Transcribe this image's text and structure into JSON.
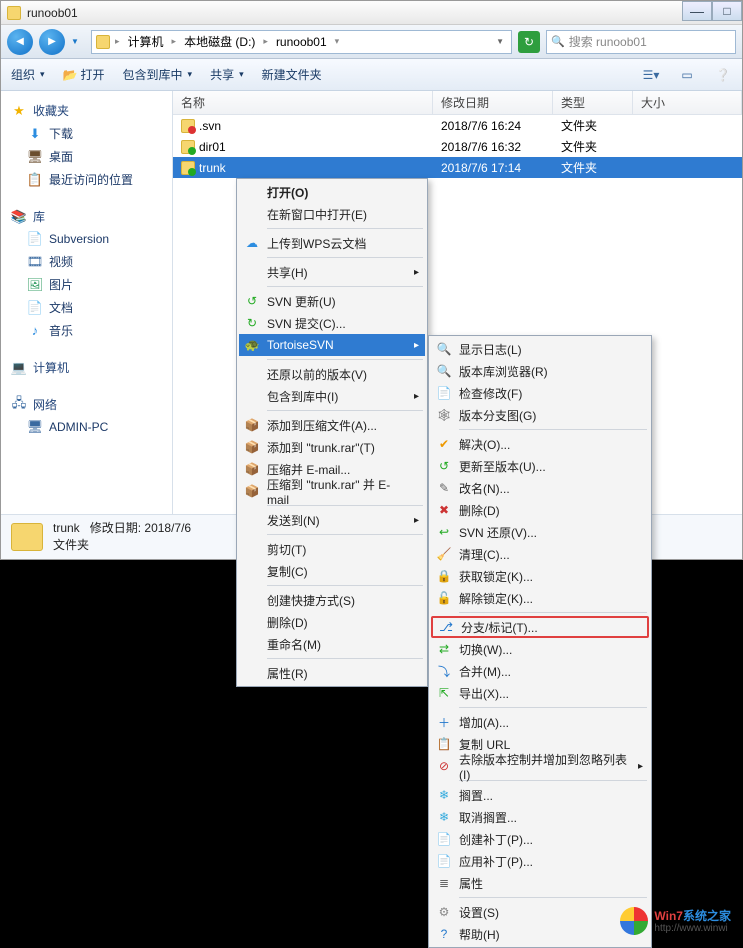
{
  "title": "runoob01",
  "breadcrumb": {
    "p1": "计算机",
    "p2": "本地磁盘 (D:)",
    "p3": "runoob01"
  },
  "search_placeholder": "搜索 runoob01",
  "toolbar": {
    "org": "组织",
    "open": "打开",
    "include": "包含到库中",
    "share": "共享",
    "newf": "新建文件夹"
  },
  "sidebar": {
    "fav": "收藏夹",
    "down": "下载",
    "desk": "桌面",
    "recent": "最近访问的位置",
    "lib": "库",
    "svn": "Subversion",
    "vid": "视频",
    "pic": "图片",
    "doc": "文档",
    "mus": "音乐",
    "comp": "计算机",
    "net": "网络",
    "pc": "ADMIN-PC"
  },
  "cols": {
    "name": "名称",
    "date": "修改日期",
    "type": "类型",
    "size": "大小"
  },
  "files": [
    {
      "name": ".svn",
      "date": "2018/7/6 16:24",
      "type": "文件夹",
      "cls": "svn"
    },
    {
      "name": "dir01",
      "date": "2018/7/6 16:32",
      "type": "文件夹",
      "cls": "ok"
    },
    {
      "name": "trunk",
      "date": "2018/7/6 17:14",
      "type": "文件夹",
      "cls": "ok",
      "sel": true
    }
  ],
  "details": {
    "name": "trunk",
    "mod_lbl": "修改日期:",
    "mod": "2018/7/6",
    "type": "文件夹"
  },
  "menu1": [
    {
      "t": "item",
      "label": "打开(O)",
      "bold": true
    },
    {
      "t": "item",
      "label": "在新窗口中打开(E)"
    },
    {
      "t": "sep"
    },
    {
      "t": "item",
      "label": "上传到WPS云文档",
      "ico": "☁",
      "icoc": "#2c8de0"
    },
    {
      "t": "sep"
    },
    {
      "t": "item",
      "label": "共享(H)",
      "sub": true
    },
    {
      "t": "sep"
    },
    {
      "t": "item",
      "label": "SVN 更新(U)",
      "ico": "↺",
      "icoc": "#2a2"
    },
    {
      "t": "item",
      "label": "SVN 提交(C)...",
      "ico": "↻",
      "icoc": "#2a2"
    },
    {
      "t": "item",
      "label": "TortoiseSVN",
      "sub": true,
      "hl": true,
      "ico": "🐢",
      "icoc": "#fff"
    },
    {
      "t": "sep"
    },
    {
      "t": "item",
      "label": "还原以前的版本(V)"
    },
    {
      "t": "item",
      "label": "包含到库中(I)",
      "sub": true
    },
    {
      "t": "sep"
    },
    {
      "t": "item",
      "label": "添加到压缩文件(A)...",
      "ico": "📦",
      "icoc": "#b33"
    },
    {
      "t": "item",
      "label": "添加到 \"trunk.rar\"(T)",
      "ico": "📦",
      "icoc": "#b33"
    },
    {
      "t": "item",
      "label": "压缩并 E-mail...",
      "ico": "📦",
      "icoc": "#b33"
    },
    {
      "t": "item",
      "label": "压缩到 \"trunk.rar\" 并 E-mail",
      "ico": "📦",
      "icoc": "#b33"
    },
    {
      "t": "sep"
    },
    {
      "t": "item",
      "label": "发送到(N)",
      "sub": true
    },
    {
      "t": "sep"
    },
    {
      "t": "item",
      "label": "剪切(T)"
    },
    {
      "t": "item",
      "label": "复制(C)"
    },
    {
      "t": "sep"
    },
    {
      "t": "item",
      "label": "创建快捷方式(S)"
    },
    {
      "t": "item",
      "label": "删除(D)"
    },
    {
      "t": "item",
      "label": "重命名(M)"
    },
    {
      "t": "sep"
    },
    {
      "t": "item",
      "label": "属性(R)"
    }
  ],
  "menu2": [
    {
      "t": "item",
      "label": "显示日志(L)",
      "ico": "🔍"
    },
    {
      "t": "item",
      "label": "版本库浏览器(R)",
      "ico": "🔍"
    },
    {
      "t": "item",
      "label": "检查修改(F)",
      "ico": "📄"
    },
    {
      "t": "item",
      "label": "版本分支图(G)",
      "ico": "🕸"
    },
    {
      "t": "sep"
    },
    {
      "t": "item",
      "label": "解决(O)...",
      "ico": "✔",
      "icoc": "#e90"
    },
    {
      "t": "item",
      "label": "更新至版本(U)...",
      "ico": "↺",
      "icoc": "#2a2"
    },
    {
      "t": "item",
      "label": "改名(N)...",
      "ico": "✎"
    },
    {
      "t": "item",
      "label": "删除(D)",
      "ico": "✖",
      "icoc": "#c33"
    },
    {
      "t": "item",
      "label": "SVN 还原(V)...",
      "ico": "↩",
      "icoc": "#2a2"
    },
    {
      "t": "item",
      "label": "清理(C)...",
      "ico": "🧹",
      "icoc": "#e90"
    },
    {
      "t": "item",
      "label": "获取锁定(K)...",
      "ico": "🔒",
      "icoc": "#c90"
    },
    {
      "t": "item",
      "label": "解除锁定(K)...",
      "ico": "🔓",
      "icoc": "#c90"
    },
    {
      "t": "sep"
    },
    {
      "t": "item",
      "label": "分支/标记(T)...",
      "ico": "⎇",
      "icoc": "#27c",
      "box": true
    },
    {
      "t": "item",
      "label": "切换(W)...",
      "ico": "⇄",
      "icoc": "#2a2"
    },
    {
      "t": "item",
      "label": "合并(M)...",
      "ico": "⤵",
      "icoc": "#27c"
    },
    {
      "t": "item",
      "label": "导出(X)...",
      "ico": "⇱",
      "icoc": "#2a2"
    },
    {
      "t": "sep"
    },
    {
      "t": "item",
      "label": "增加(A)...",
      "ico": "＋",
      "icoc": "#27c"
    },
    {
      "t": "item",
      "label": "复制 URL",
      "ico": "📋"
    },
    {
      "t": "item",
      "label": "去除版本控制并增加到忽略列表(I)",
      "sub": true,
      "ico": "⊘",
      "icoc": "#c33"
    },
    {
      "t": "sep"
    },
    {
      "t": "item",
      "label": "搁置...",
      "ico": "❄",
      "icoc": "#3ad"
    },
    {
      "t": "item",
      "label": "取消搁置...",
      "ico": "❄",
      "icoc": "#3ad"
    },
    {
      "t": "item",
      "label": "创建补丁(P)...",
      "ico": "📄",
      "icoc": "#c90"
    },
    {
      "t": "item",
      "label": "应用补丁(P)...",
      "ico": "📄",
      "icoc": "#c90"
    },
    {
      "t": "item",
      "label": "属性",
      "ico": "≣"
    },
    {
      "t": "sep"
    },
    {
      "t": "item",
      "label": "设置(S)",
      "ico": "⚙",
      "icoc": "#888"
    },
    {
      "t": "item",
      "label": "帮助(H)",
      "ico": "?",
      "icoc": "#27c"
    }
  ],
  "watermark": {
    "brand1": "Win7",
    "brand2": "系统之家",
    "url": "http://www.winwi"
  }
}
